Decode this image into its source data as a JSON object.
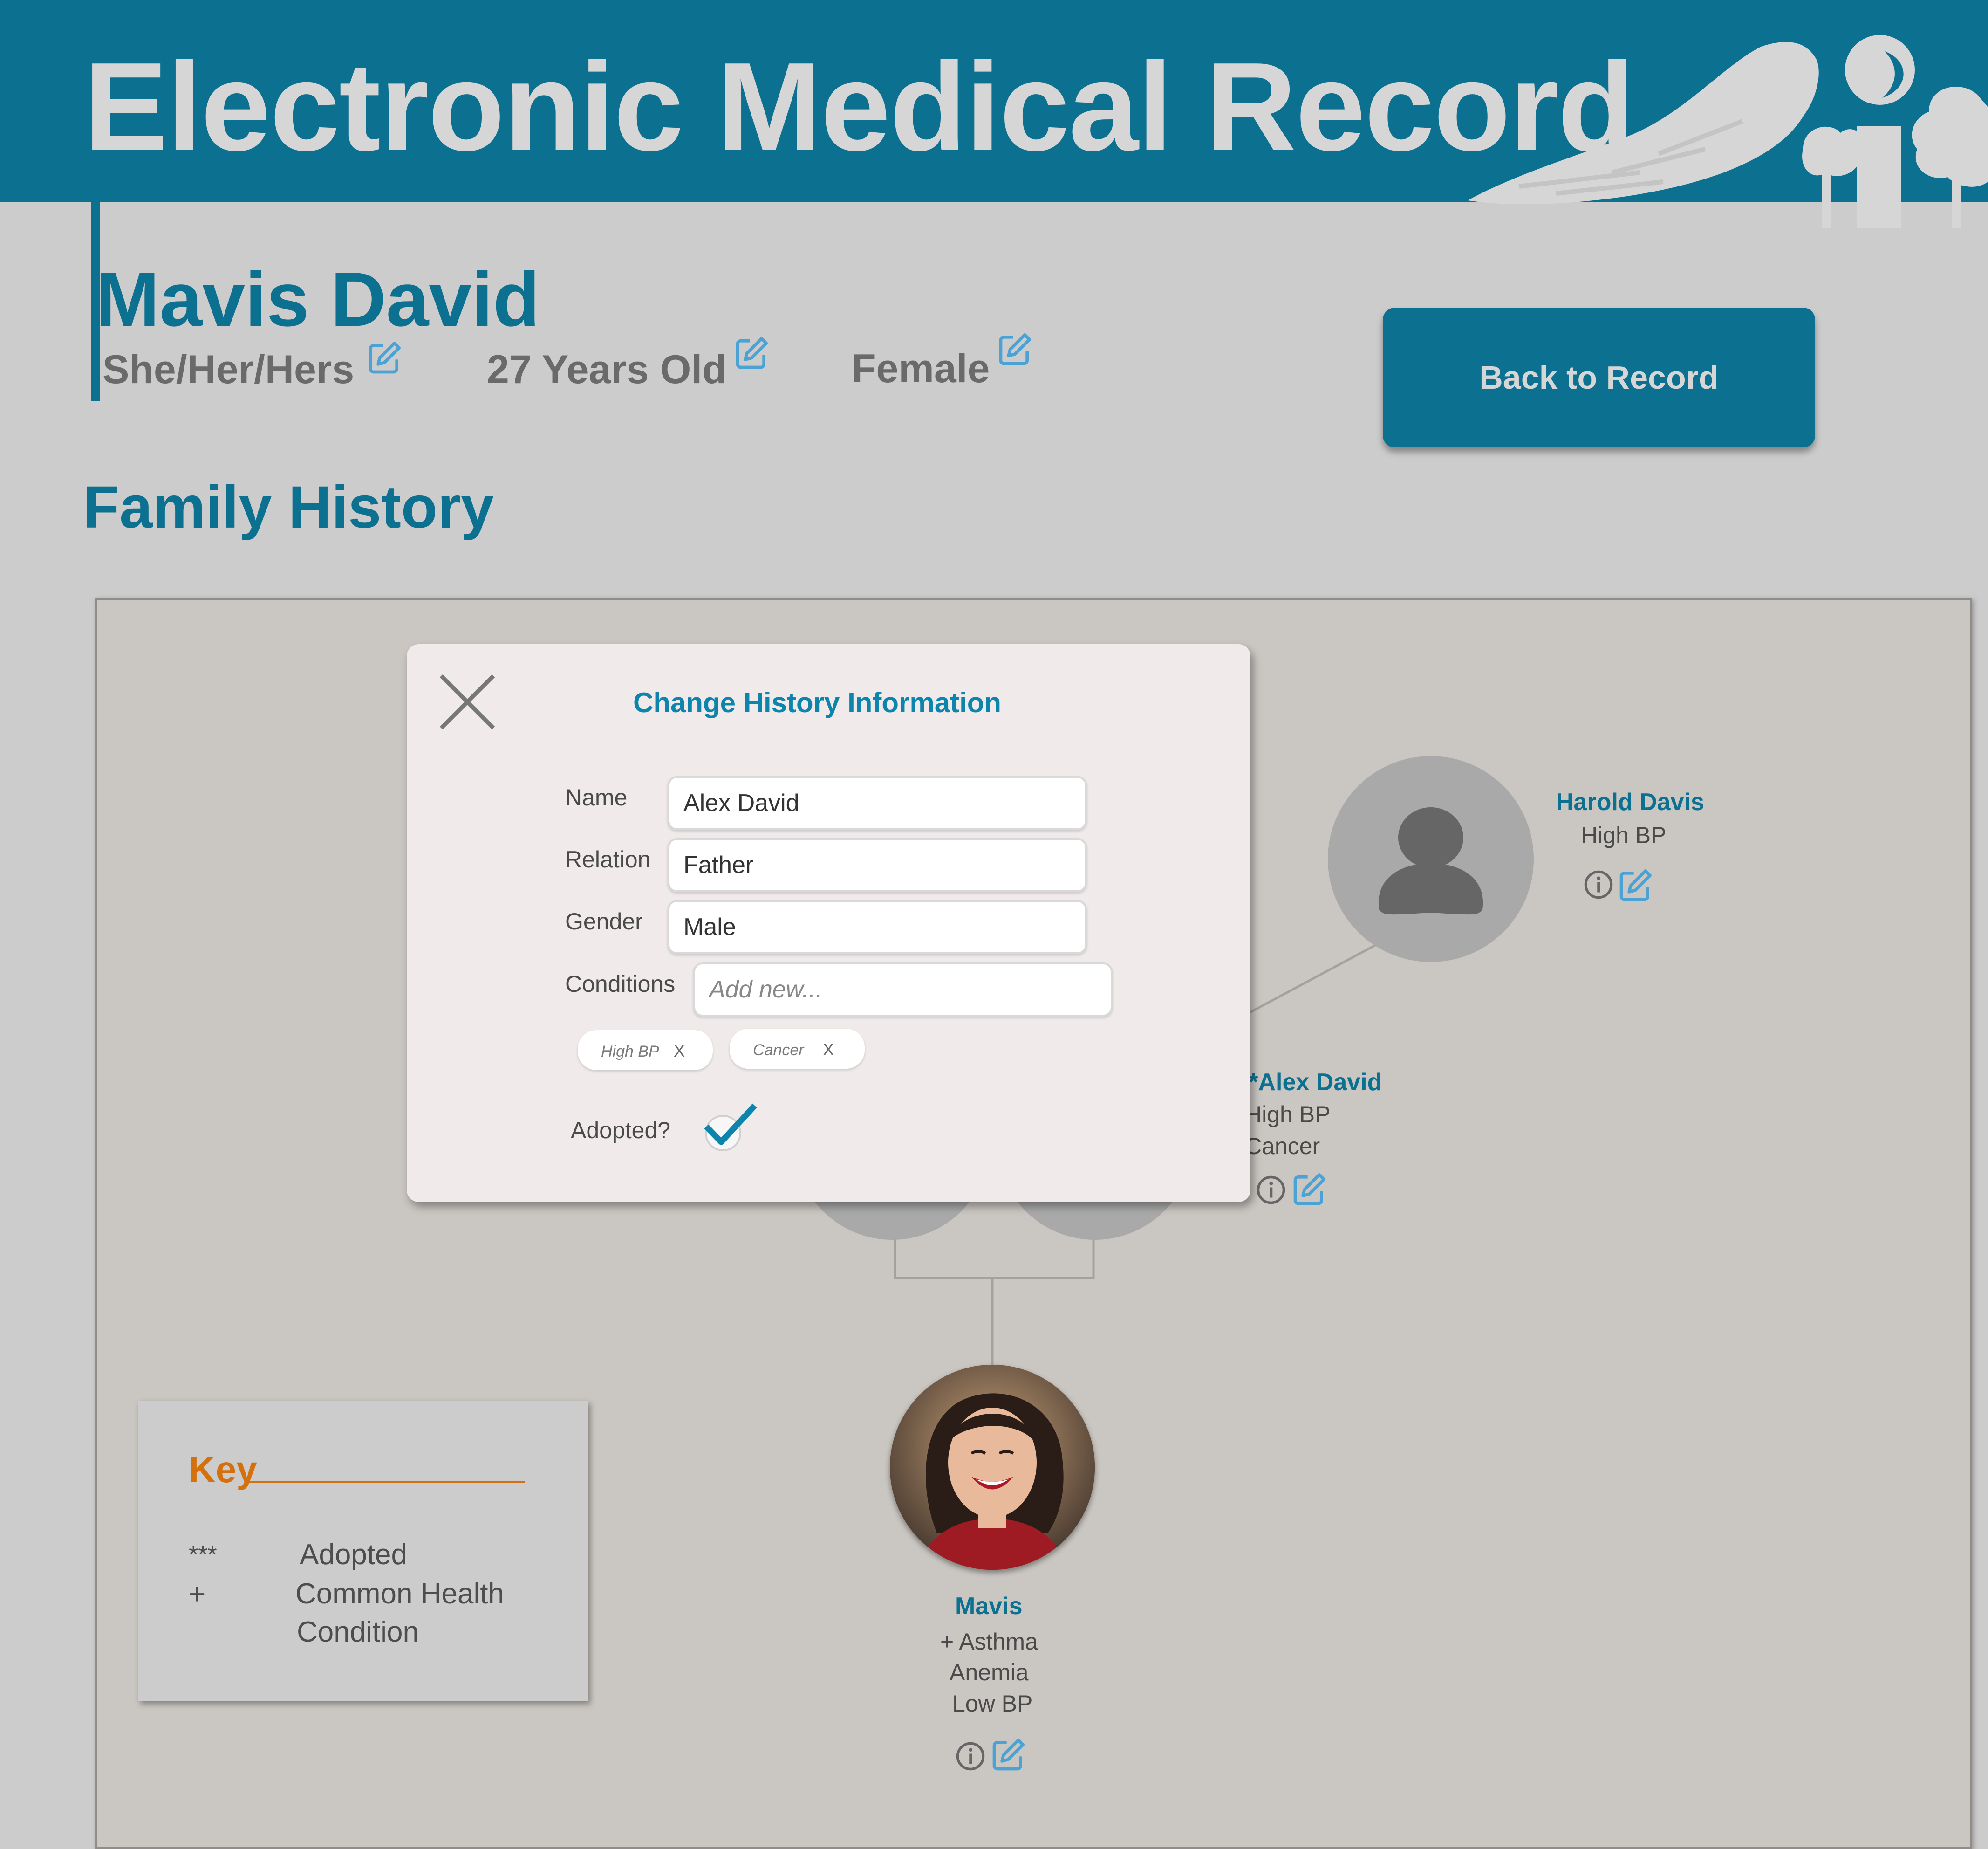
{
  "app": {
    "title": "Electronic Medical Record"
  },
  "patient": {
    "name": "Mavis David",
    "pronouns": "She/Her/Hers",
    "age": "27 Years Old",
    "gender": "Female"
  },
  "actions": {
    "back_label": "Back to Record"
  },
  "section": {
    "title": "Family History"
  },
  "tree": {
    "grandparent": {
      "name": "Harold Davis",
      "conditions": [
        "High BP"
      ]
    },
    "father": {
      "name": "**Alex David",
      "conditions": [
        "High BP",
        "Cancer"
      ]
    },
    "patient": {
      "name": "Mavis",
      "conditions": [
        "+ Asthma",
        "Anemia",
        "Low BP"
      ]
    }
  },
  "key": {
    "title": "Key",
    "items": [
      {
        "symbol": "***",
        "label": "Adopted"
      },
      {
        "symbol": "+",
        "label": "Common Health",
        "label2": "Condition"
      }
    ]
  },
  "modal": {
    "title": "Change History Information",
    "fields": {
      "name": {
        "label": "Name",
        "value": "Alex David"
      },
      "relation": {
        "label": "Relation",
        "value": "Father"
      },
      "gender": {
        "label": "Gender",
        "value": "Male"
      },
      "conditions": {
        "label": "Conditions",
        "placeholder": "Add new..."
      }
    },
    "tags": [
      {
        "label": "High BP",
        "remove": "X"
      },
      {
        "label": "Cancer",
        "remove": "X"
      }
    ],
    "adopted": {
      "label": "Adopted?",
      "checked": true
    }
  },
  "icons": {
    "edit": "edit-icon",
    "info": "info-icon",
    "close": "close-icon",
    "check": "checkmark-icon",
    "person": "person-placeholder-icon"
  },
  "colors": {
    "brand": "#0c7090",
    "accent": "#d4700e",
    "edit_icon": "#4aa3d4",
    "panel": "#cac6c1"
  }
}
